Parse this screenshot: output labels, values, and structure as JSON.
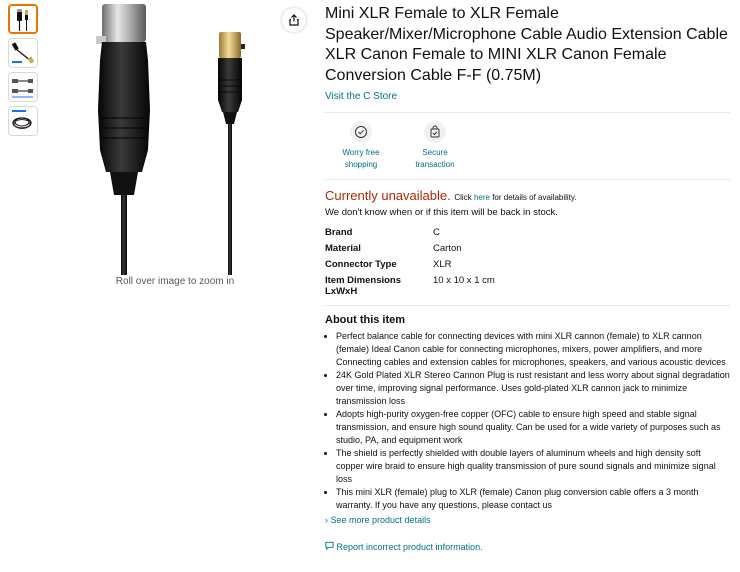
{
  "title": "Mini XLR Female to XLR Female Speaker/Mixer/Microphone Cable Audio Extension Cable XLR Canon Female to MINI XLR Canon Female Conversion Cable F-F (0.75M)",
  "store_link": "Visit the C Store",
  "zoom_hint": "Roll over image to zoom in",
  "thumbnails": [
    {
      "icon": "cable-photo-thumbnail"
    },
    {
      "icon": "cable-side-thumbnail"
    },
    {
      "icon": "dimension-diagram-thumbnail"
    },
    {
      "icon": "coiled-cable-thumbnail"
    }
  ],
  "badges": [
    {
      "label_1": "Worry free",
      "label_2": "shopping",
      "icon": "shield-check-icon"
    },
    {
      "label_1": "Secure",
      "label_2": "transaction",
      "icon": "secure-bag-icon"
    }
  ],
  "availability": {
    "status": "Currently unavailable.",
    "click_prefix": "Click",
    "here_link": "here",
    "click_suffix": "for details of availability.",
    "note": "We don't know when or if this item will be back in stock."
  },
  "specs": [
    {
      "key": "Brand",
      "value": "C"
    },
    {
      "key": "Material",
      "value": "Carton"
    },
    {
      "key": "Connector Type",
      "value": "XLR"
    },
    {
      "key": "Item Dimensions LxWxH",
      "value": "10 x 10 x 1 cm"
    }
  ],
  "about": {
    "heading": "About this item",
    "bullets": [
      "Perfect balance cable for connecting devices with mini XLR cannon (female) to XLR cannon (female) Ideal Canon cable for connecting microphones, mixers, power amplifiers, and more Connecting cables and extension cables for microphones, speakers, and various acoustic devices",
      "24K Gold Plated XLR Stereo Cannon Plug is rust resistant and less worry about signal degradation over time, improving signal performance. Uses gold-plated XLR cannon jack to minimize transmission loss",
      "Adopts high-purity oxygen-free copper (OFC) cable to ensure high speed and stable signal transmission, and ensure high sound quality. Can be used for a wide variety of purposes such as studio, PA, and equipment work",
      "The shield is perfectly shielded with double layers of aluminum wheels and high density soft copper wire braid to ensure high quality transmission of pure sound signals and minimize signal loss",
      "This mini XLR (female) plug to XLR (female) Canon plug conversion cable offers a 3 month warranty. If you have any questions, please contact us"
    ],
    "see_more": "See more product details"
  },
  "report_link": "Report incorrect product information.",
  "colors": {
    "link": "#007185",
    "unavailable": "#b12704",
    "thumb_active": "#e77600"
  }
}
